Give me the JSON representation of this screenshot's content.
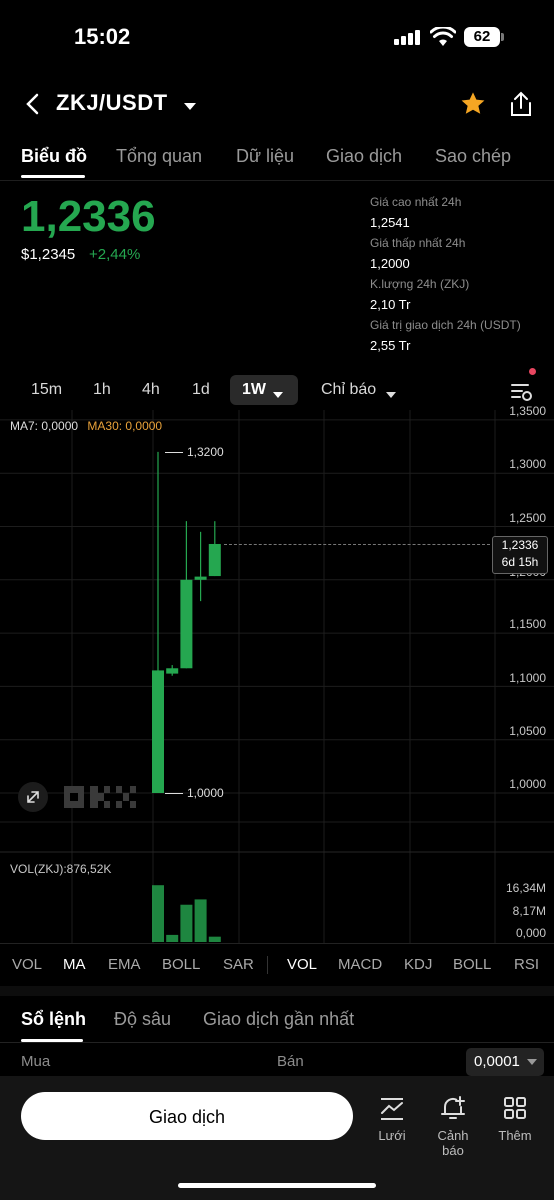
{
  "status_bar": {
    "time": "15:02",
    "battery": "62"
  },
  "header": {
    "pair": "ZKJ/USDT"
  },
  "tabs": [
    "Biểu đồ",
    "Tổng quan",
    "Dữ liệu",
    "Giao dịch",
    "Sao chép"
  ],
  "price": {
    "last": "1,2336",
    "usd": "$1,2345",
    "change": "+2,44%"
  },
  "stats": [
    {
      "label": "Giá cao nhất 24h",
      "value": "1,2541"
    },
    {
      "label": "Giá thấp nhất 24h",
      "value": "1,2000"
    },
    {
      "label": "K.lượng 24h (ZKJ)",
      "value": "2,10 Tr"
    },
    {
      "label": "Giá trị giao dịch 24h (USDT)",
      "value": "2,55 Tr"
    }
  ],
  "intervals": [
    "15m",
    "1h",
    "4h",
    "1d",
    "1W"
  ],
  "indicator_menu": "Chỉ báo",
  "chart": {
    "ma7": "MA7: 0,0000",
    "ma30": "MA30: 0,0000",
    "y_ticks": [
      "1,3500",
      "1,3000",
      "1,2500",
      "1,2000",
      "1,1500",
      "1,1000",
      "1,0500",
      "1,0000"
    ],
    "high_label": "1,3200",
    "low_label": "1,0000",
    "current_label": "1,2336",
    "countdown": "6d 15h",
    "vol_legend": "VOL(ZKJ):876,52K",
    "vol_ticks": [
      "16,34M",
      "8,17M",
      "0,000"
    ]
  },
  "chart_data": {
    "type": "candlestick",
    "ylim": [
      0.97,
      1.36
    ],
    "candles": [
      {
        "open": 1.0,
        "close": 1.115,
        "high": 1.32,
        "low": 1.0
      },
      {
        "open": 1.112,
        "close": 1.117,
        "high": 1.12,
        "low": 1.11
      },
      {
        "open": 1.117,
        "close": 1.2,
        "high": 1.255,
        "low": 1.117
      },
      {
        "open": 1.2,
        "close": 1.203,
        "high": 1.245,
        "low": 1.18
      },
      {
        "open": 1.2035,
        "close": 1.2336,
        "high": 1.255,
        "low": 1.2035
      }
    ],
    "volume_max": 16.34,
    "volumes": [
      16.0,
      2.0,
      10.5,
      12.0,
      1.5
    ]
  },
  "indicator_tabs": {
    "main": [
      "VOL",
      "MA",
      "EMA",
      "BOLL",
      "SAR"
    ],
    "sub": [
      "VOL",
      "MACD",
      "KDJ",
      "BOLL",
      "RSI"
    ]
  },
  "orderbook": {
    "tabs": [
      "Sổ lệnh",
      "Độ sâu",
      "Giao dịch gần nhất"
    ],
    "buy": "Mua",
    "sell": "Bán",
    "precision": "0,0001"
  },
  "bottom": {
    "trade": "Giao dịch",
    "grid": "Lưới",
    "alerts": "Cảnh báo",
    "more": "Thêm"
  },
  "colors": {
    "up": "#25a750",
    "accent_star": "#f5a623",
    "ma30": "#e8a23a"
  }
}
